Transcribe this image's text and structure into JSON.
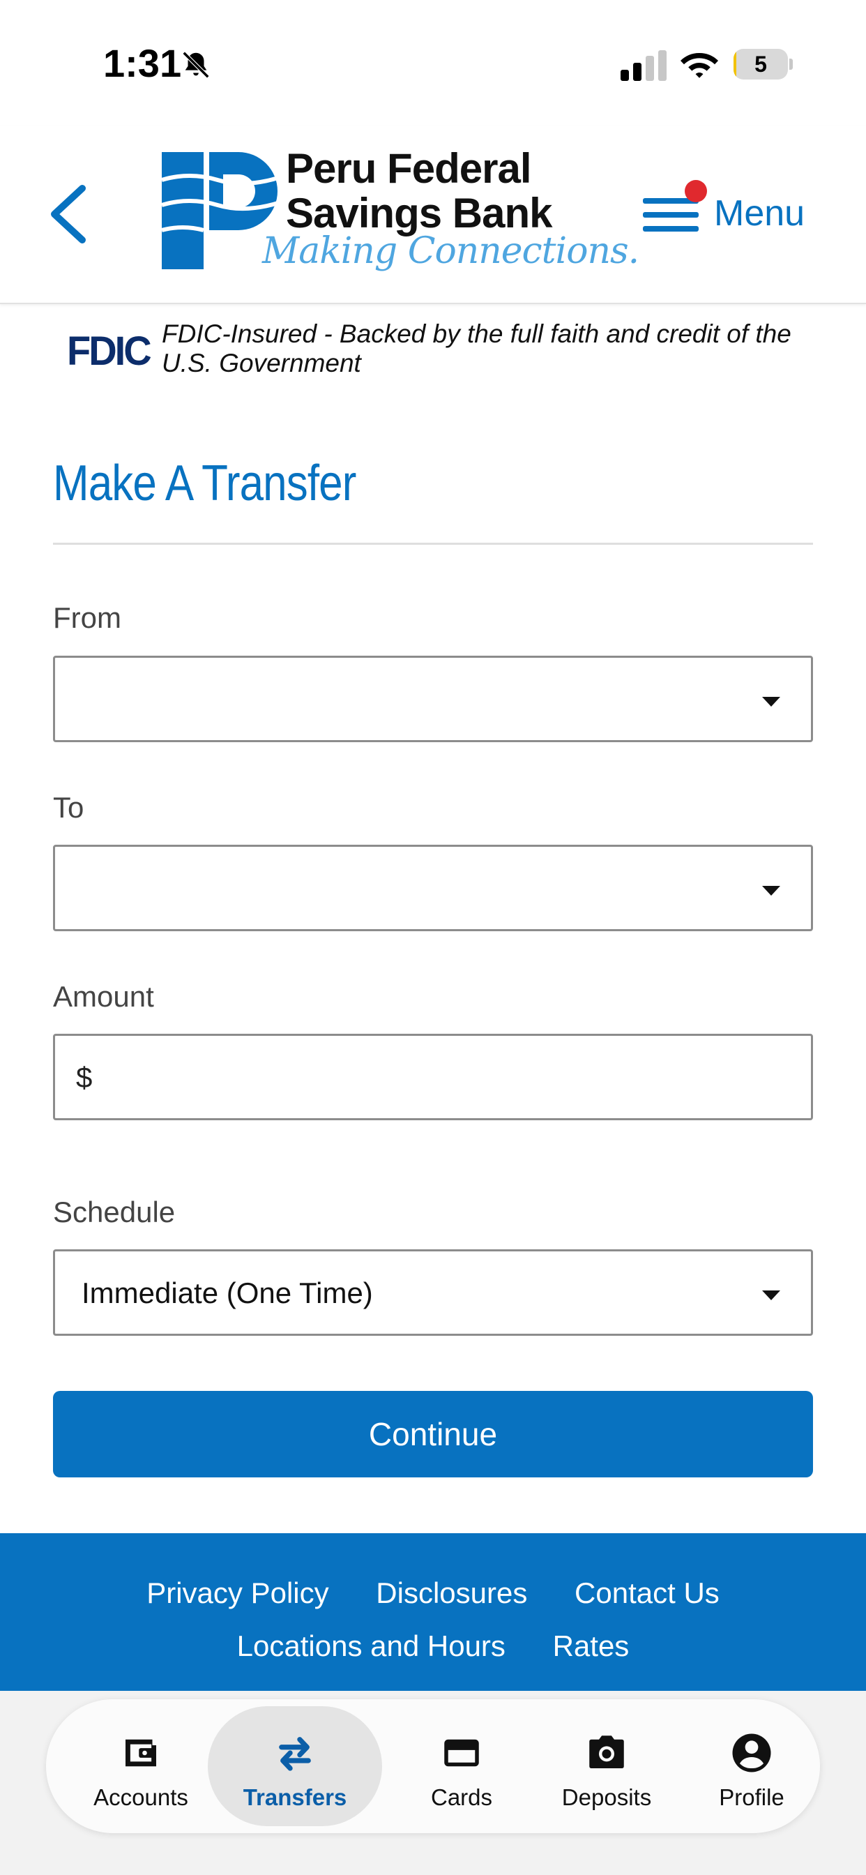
{
  "status_bar": {
    "time": "1:31",
    "battery_level": "5",
    "battery_fraction": 0.05
  },
  "header": {
    "bank_name_line1": "Peru Federal",
    "bank_name_line2": "Savings Bank",
    "tagline": "Making Connections.",
    "menu_label": "Menu",
    "brand_color": "#0872c0",
    "notification_color": "#e0292e"
  },
  "fdic": {
    "logo_text": "FDIC",
    "statement": "FDIC-Insured - Backed by the full faith and credit of the U.S. Government"
  },
  "transfer_form": {
    "title": "Make A Transfer",
    "from_label": "From",
    "from_value": "",
    "to_label": "To",
    "to_value": "",
    "amount_label": "Amount",
    "currency_symbol": "$",
    "amount_value": "",
    "schedule_label": "Schedule",
    "schedule_value": "Immediate (One Time)",
    "continue_label": "Continue"
  },
  "footer": {
    "links_row1": [
      "Privacy Policy",
      "Disclosures",
      "Contact Us"
    ],
    "links_row2": [
      "Locations and Hours",
      "Rates"
    ]
  },
  "tab_bar": {
    "active": "Transfers",
    "tabs": [
      {
        "label": "Accounts",
        "icon": "wallet-icon"
      },
      {
        "label": "Transfers",
        "icon": "transfer-arrows-icon"
      },
      {
        "label": "Cards",
        "icon": "credit-card-icon"
      },
      {
        "label": "Deposits",
        "icon": "camera-icon"
      },
      {
        "label": "Profile",
        "icon": "profile-icon"
      }
    ]
  }
}
